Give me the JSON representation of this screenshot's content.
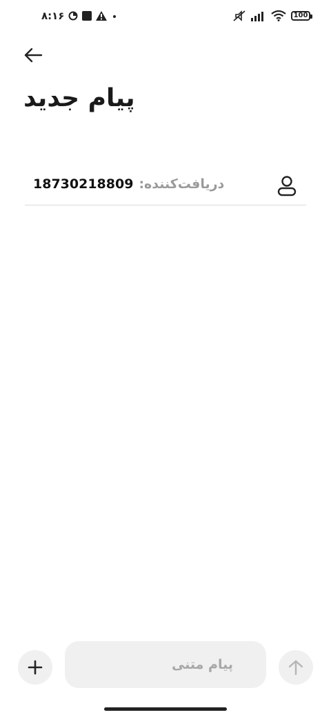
{
  "status_bar": {
    "time": "۸:۱۶",
    "battery": "100",
    "icons": [
      "data-saver-icon",
      "app-notification-icon",
      "warning-icon",
      "dot-icon",
      "muted-icon",
      "signal-icon",
      "wifi-icon",
      "battery-icon"
    ]
  },
  "header": {
    "title": "پیام جدید",
    "back_icon": "arrow-left-icon"
  },
  "recipient": {
    "label": "دریافت‌کننده:",
    "value": "18730218809",
    "icon": "person-icon"
  },
  "composer": {
    "placeholder": "پیام متنی",
    "add_icon": "plus-icon",
    "send_icon": "arrow-up-icon"
  },
  "colors": {
    "background": "#ffffff",
    "muted_text": "#9a9a9a",
    "input_bg": "#f0f0f0",
    "divider": "#d9d9d9"
  }
}
